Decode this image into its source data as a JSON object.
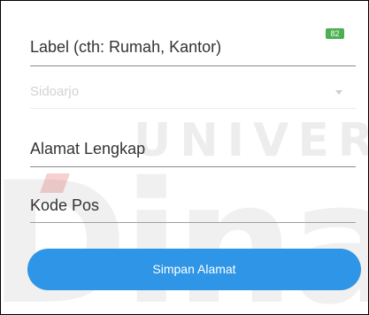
{
  "badge": {
    "count": "82",
    "color": "#4caf50"
  },
  "form": {
    "label_field": {
      "placeholder": "Label (cth: Rumah, Kantor)"
    },
    "city_field": {
      "value": "Sidoarjo"
    },
    "address_field": {
      "placeholder": "Alamat Lengkap"
    },
    "zip_field": {
      "placeholder": "Kode Pos"
    }
  },
  "save_button": {
    "label": "Simpan Alamat",
    "color": "#2f95e6"
  },
  "watermark": {
    "top_text": "UNIVERS",
    "big_text": "Dinan"
  }
}
